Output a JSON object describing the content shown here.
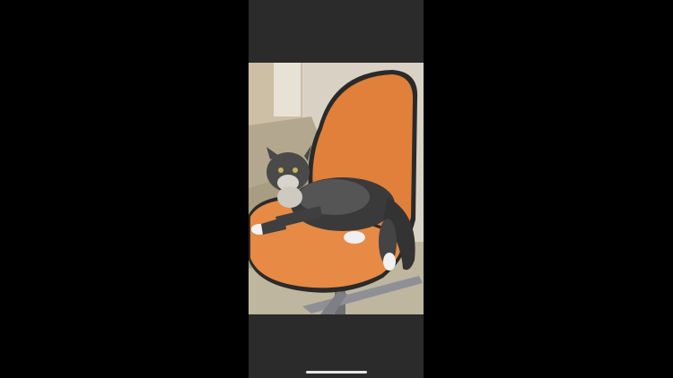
{
  "viewer": {
    "background_color": "#000000",
    "screen_color": "#2b2b2b",
    "home_indicator_color": "#e6e6e6"
  },
  "photo": {
    "subject": "cat-on-orange-chair"
  }
}
